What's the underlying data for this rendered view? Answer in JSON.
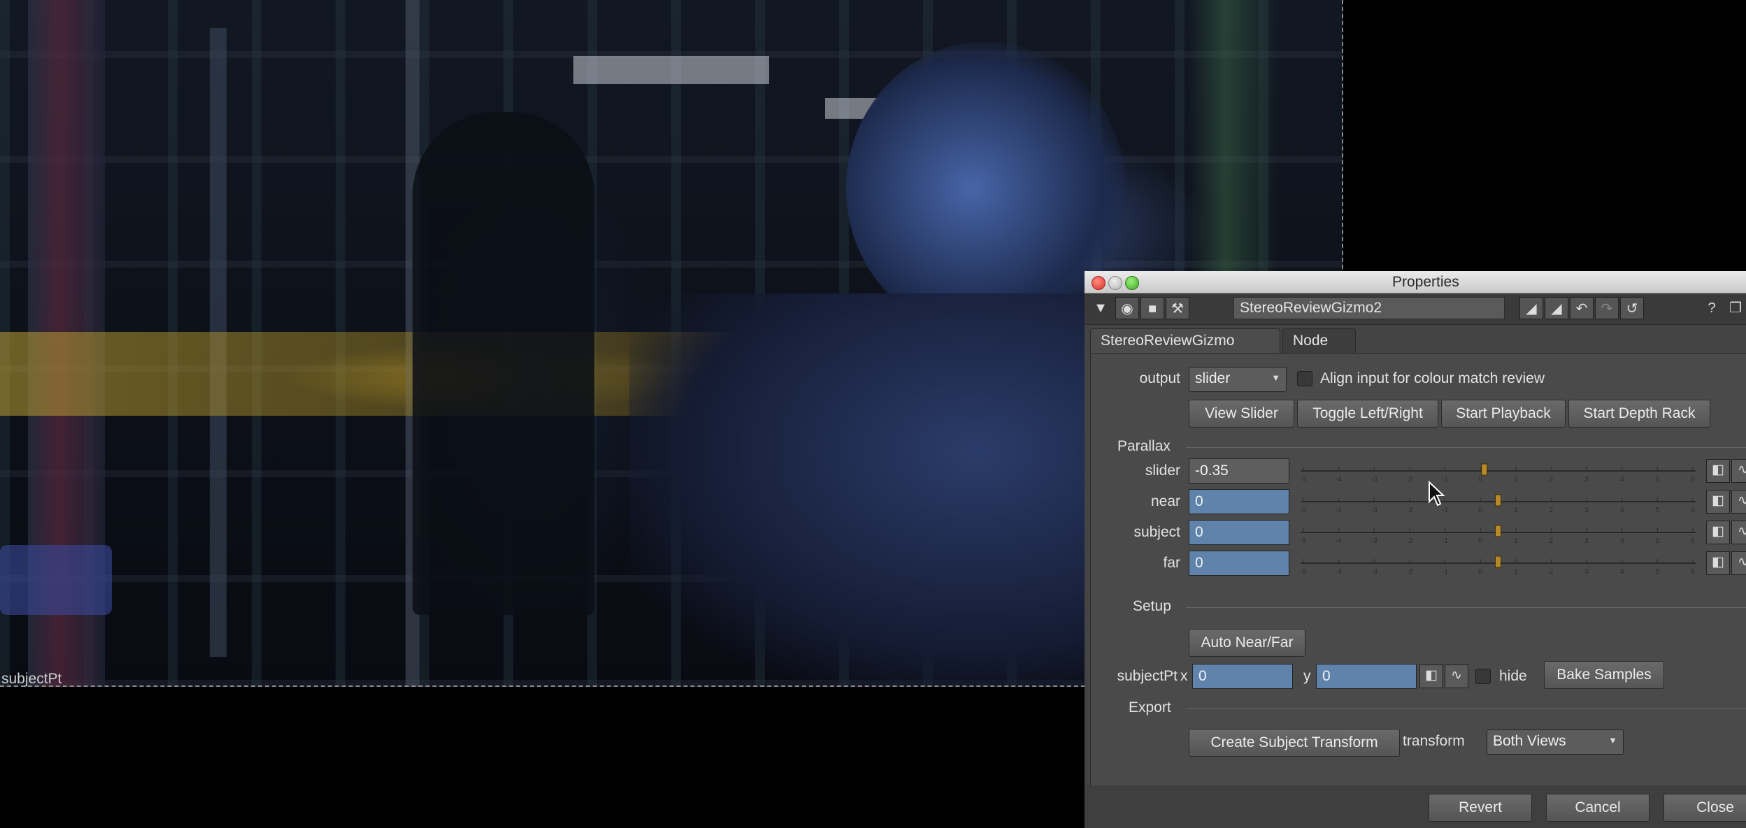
{
  "viewer": {
    "overlay_label": "subjectPt"
  },
  "window": {
    "title": "Properties",
    "node_name": "StereoReviewGizmo2"
  },
  "toolbar": {
    "icons": [
      "collapse-triangle-icon",
      "circle-icon",
      "viewer-icon",
      "wrench-icon",
      "input-a-icon",
      "input-b-icon",
      "undo-icon",
      "redo-icon",
      "revert-icon",
      "help-icon",
      "float-icon"
    ]
  },
  "tabs": [
    {
      "label": "StereoReviewGizmo"
    },
    {
      "label": "Node"
    }
  ],
  "output": {
    "label": "output",
    "value": "slider",
    "align_label": "Align input for colour match review"
  },
  "buttons": {
    "view_slider": "View Slider",
    "toggle_lr": "Toggle Left/Right",
    "start_playback": "Start Playback",
    "start_depth_rack": "Start Depth Rack",
    "auto_near_far": "Auto Near/Far",
    "bake_samples": "Bake Samples",
    "create_subject_transform": "Create Subject Transform",
    "revert": "Revert",
    "cancel": "Cancel",
    "close": "Close"
  },
  "sections": {
    "parallax": "Parallax",
    "setup": "Setup",
    "export": "Export"
  },
  "parallax": [
    {
      "label": "slider",
      "value": "-0.35",
      "fraction": 0.465
    },
    {
      "label": "near",
      "value": "0",
      "fraction": 0.5
    },
    {
      "label": "subject",
      "value": "0",
      "fraction": 0.5
    },
    {
      "label": "far",
      "value": "0",
      "fraction": 0.5
    }
  ],
  "slider_ticks": [
    "-5",
    "-4",
    "-3",
    "-2",
    "-1",
    "0",
    "1",
    "2",
    "3",
    "4",
    "5",
    "6"
  ],
  "setup": {
    "subjectpt_label": "subjectPt",
    "x_label": "x",
    "x_value": "0",
    "y_label": "y",
    "y_value": "0",
    "hide_label": "hide"
  },
  "export": {
    "transform_label": "transform",
    "transform_value": "Both Views"
  },
  "colors": {
    "field_blue": "#5f83ab",
    "panel_bg": "#4a4a4a",
    "slider_handle": "#b8892a"
  }
}
